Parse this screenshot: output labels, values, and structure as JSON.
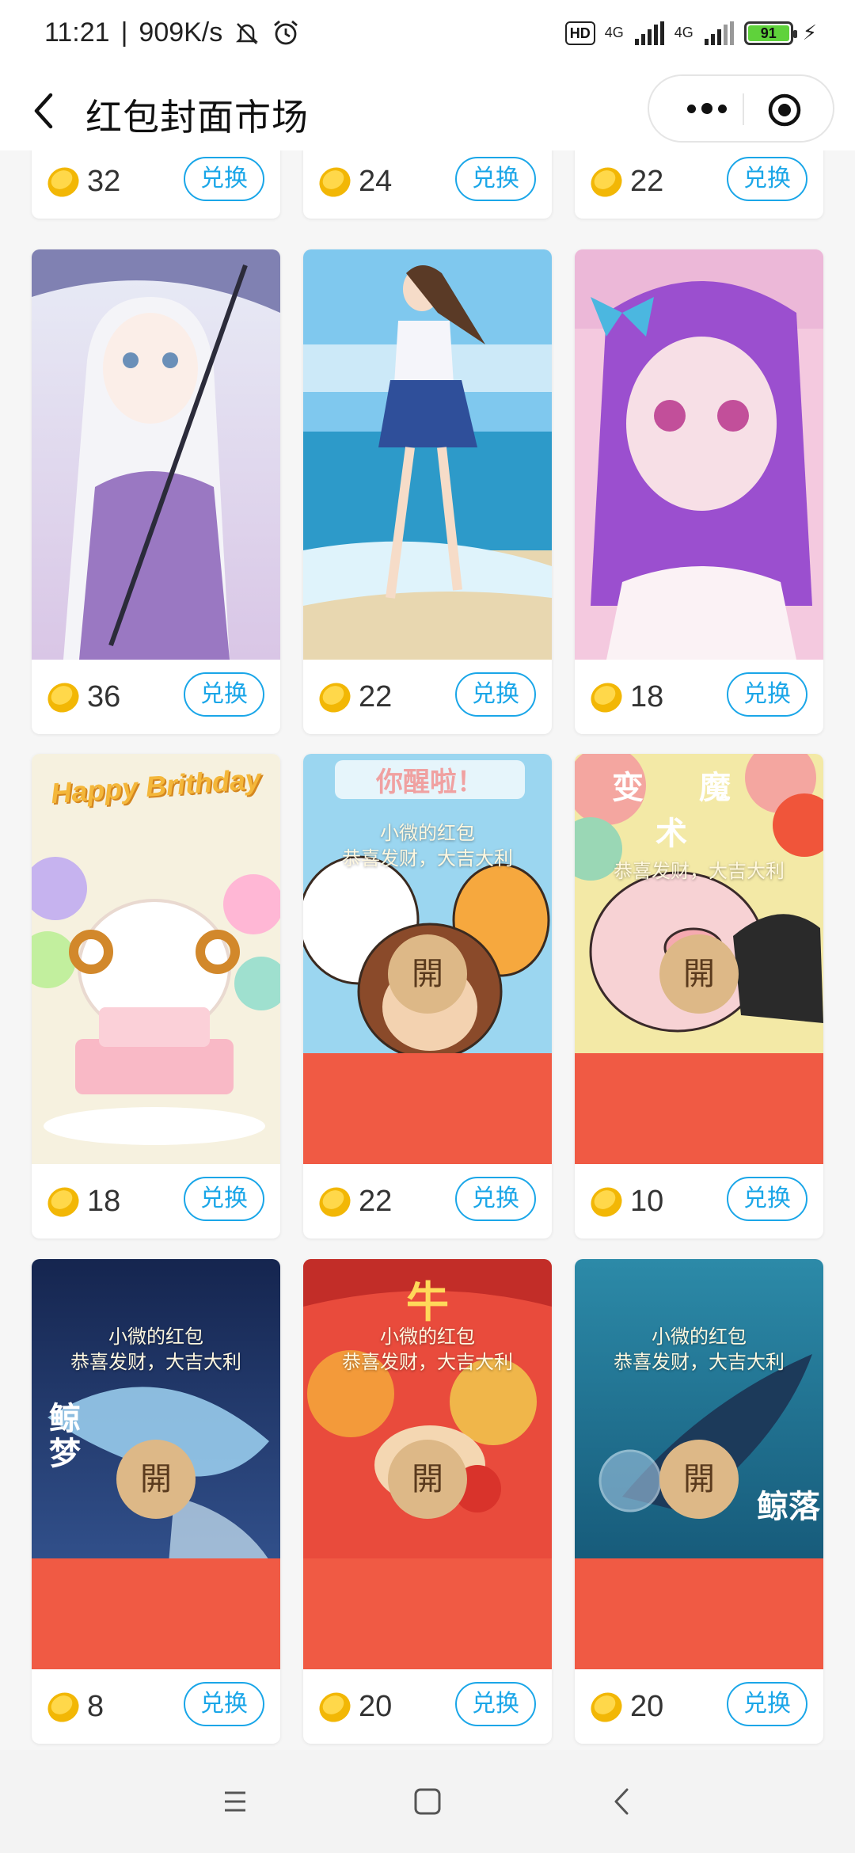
{
  "status": {
    "time": "11:21",
    "speed": "909K/s",
    "hd": "HD",
    "net1": "4G",
    "net2": "4G",
    "battery": "91"
  },
  "nav": {
    "title": "红包封面市场"
  },
  "colors": {
    "accent": "#1aa6e8",
    "envelope_red": "#f05a44",
    "open_gold": "#ddb887",
    "coin": "#f5c518"
  },
  "exchange_label": "兑换",
  "open_char": "開",
  "cover_text": {
    "owner": "小微的红包",
    "greeting": "恭喜发财，大吉大利"
  },
  "cards": [
    {
      "price": "32",
      "image": "partial-cover"
    },
    {
      "price": "24",
      "image": "partial-cover"
    },
    {
      "price": "22",
      "image": "partial-cover"
    },
    {
      "price": "36",
      "image": "anime-girl-umbrella"
    },
    {
      "price": "22",
      "image": "anime-girl-beach"
    },
    {
      "price": "18",
      "image": "anime-girl-purple-hair"
    },
    {
      "price": "18",
      "image": "birthday-sheep-cake",
      "text": "Happy Brithday"
    },
    {
      "price": "22",
      "image": "sheep-tiger-monkey-envelope",
      "text": "你醒啦！"
    },
    {
      "price": "10",
      "image": "pig-magician-envelope",
      "text": "变魔术"
    },
    {
      "price": "8",
      "image": "whale-dream-envelope",
      "text": "鲸梦"
    },
    {
      "price": "20",
      "image": "ox-new-year-envelope",
      "text": "牛"
    },
    {
      "price": "20",
      "image": "whale-fall-envelope",
      "text": "鲸落"
    }
  ]
}
